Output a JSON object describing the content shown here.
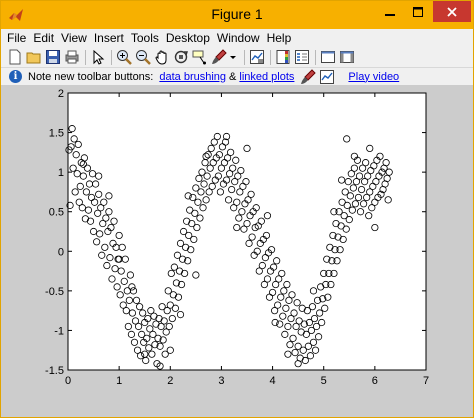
{
  "window": {
    "title": "Figure 1"
  },
  "menu": [
    "File",
    "Edit",
    "View",
    "Insert",
    "Tools",
    "Desktop",
    "Window",
    "Help"
  ],
  "toolbar": {
    "icons": [
      "new-figure-icon",
      "open-file-icon",
      "save-icon",
      "print-icon",
      "edit-plot-icon",
      "zoom-in-icon",
      "zoom-out-icon",
      "pan-icon",
      "rotate-3d-icon",
      "data-cursor-icon",
      "brush-icon",
      "link-plot-icon",
      "colorbar-icon",
      "legend-icon",
      "hide-plot-tools-icon",
      "show-plot-tools-icon"
    ]
  },
  "infobar": {
    "prefix": "Note new toolbar buttons:",
    "link1": "data brushing",
    "amp": "&",
    "link2": "linked plots",
    "link3": "Play video"
  },
  "colors": {
    "titlebar": "#f7b000",
    "close": "#c7372f",
    "figure_bg": "#cccccc",
    "axes_bg": "#ffffff"
  },
  "chart_data": {
    "type": "scatter",
    "marker": "open-circle",
    "xlim": [
      0,
      7
    ],
    "ylim": [
      -1.5,
      2
    ],
    "xticks": [
      0,
      1,
      2,
      3,
      4,
      5,
      6,
      7
    ],
    "yticks": [
      -1.5,
      -1,
      -0.5,
      0,
      0.5,
      1,
      1.5,
      2
    ],
    "xtick_labels": [
      "0",
      "1",
      "2",
      "3",
      "4",
      "5",
      "6",
      "7"
    ],
    "ytick_labels": [
      "-1.5",
      "-1",
      "-0.5",
      "0",
      "0.5",
      "1",
      "1.5",
      "2"
    ],
    "grid": false,
    "points": [
      [
        0.02,
        1.28
      ],
      [
        0.04,
        0.58
      ],
      [
        0.06,
        1.32
      ],
      [
        0.08,
        1.55
      ],
      [
        0.1,
        1.05
      ],
      [
        0.12,
        1.42
      ],
      [
        0.14,
        0.75
      ],
      [
        0.16,
        1.22
      ],
      [
        0.18,
        0.98
      ],
      [
        0.2,
        1.35
      ],
      [
        0.22,
        0.62
      ],
      [
        0.24,
        0.82
      ],
      [
        0.26,
        1.12
      ],
      [
        0.28,
        0.55
      ],
      [
        0.3,
        0.95
      ],
      [
        0.32,
        1.18
      ],
      [
        0.34,
        0.41
      ],
      [
        0.36,
        0.75
      ],
      [
        0.38,
        1.05
      ],
      [
        0.4,
        0.52
      ],
      [
        0.42,
        0.85
      ],
      [
        0.44,
        0.38
      ],
      [
        0.46,
        0.68
      ],
      [
        0.48,
        0.98
      ],
      [
        0.5,
        0.25
      ],
      [
        0.52,
        0.62
      ],
      [
        0.54,
        0.85
      ],
      [
        0.56,
        0.12
      ],
      [
        0.58,
        0.48
      ],
      [
        0.6,
        0.72
      ],
      [
        0.62,
        0.22
      ],
      [
        0.64,
        0.55
      ],
      [
        0.66,
        -0.05
      ],
      [
        0.68,
        0.35
      ],
      [
        0.7,
        0.62
      ],
      [
        0.72,
        0.05
      ],
      [
        0.74,
        0.42
      ],
      [
        0.76,
        -0.18
      ],
      [
        0.78,
        0.25
      ],
      [
        0.8,
        0.5
      ],
      [
        0.82,
        -0.08
      ],
      [
        0.84,
        0.3
      ],
      [
        0.86,
        -0.35
      ],
      [
        0.88,
        0.1
      ],
      [
        0.9,
        0.38
      ],
      [
        0.92,
        -0.22
      ],
      [
        0.94,
        0.05
      ],
      [
        0.96,
        -0.45
      ],
      [
        0.98,
        -0.1
      ],
      [
        1.0,
        0.2
      ],
      [
        1.02,
        -0.55
      ],
      [
        1.04,
        -0.25
      ],
      [
        1.06,
        0.05
      ],
      [
        1.08,
        -0.68
      ],
      [
        1.1,
        -0.38
      ],
      [
        1.12,
        -0.1
      ],
      [
        1.14,
        -0.75
      ],
      [
        1.16,
        -0.5
      ],
      [
        1.18,
        -0.95
      ],
      [
        1.2,
        -0.62
      ],
      [
        1.22,
        -0.3
      ],
      [
        1.24,
        -1.05
      ],
      [
        1.26,
        -0.78
      ],
      [
        1.28,
        -0.5
      ],
      [
        1.3,
        -1.15
      ],
      [
        1.32,
        -0.88
      ],
      [
        1.34,
        -0.62
      ],
      [
        1.36,
        -1.25
      ],
      [
        1.38,
        -0.95
      ],
      [
        1.4,
        -0.7
      ],
      [
        1.42,
        -1.32
      ],
      [
        1.44,
        -1.05
      ],
      [
        1.46,
        -0.78
      ],
      [
        1.48,
        -1.15
      ],
      [
        1.5,
        -0.9
      ],
      [
        1.52,
        -1.38
      ],
      [
        1.54,
        -1.1
      ],
      [
        1.56,
        -0.85
      ],
      [
        1.58,
        -1.22
      ],
      [
        1.6,
        -0.98
      ],
      [
        1.62,
        -0.75
      ],
      [
        1.64,
        -1.3
      ],
      [
        1.66,
        -1.05
      ],
      [
        1.68,
        -0.82
      ],
      [
        1.7,
        -1.18
      ],
      [
        1.72,
        -0.92
      ],
      [
        1.74,
        -1.42
      ],
      [
        1.76,
        -1.1
      ],
      [
        1.78,
        -0.85
      ],
      [
        1.8,
        -1.2
      ],
      [
        1.82,
        -0.95
      ],
      [
        1.84,
        -0.7
      ],
      [
        1.86,
        -1.12
      ],
      [
        1.88,
        -0.88
      ],
      [
        1.9,
        -1.3
      ],
      [
        1.92,
        -1.02
      ],
      [
        1.94,
        -0.75
      ],
      [
        1.96,
        -0.5
      ],
      [
        1.98,
        -0.95
      ],
      [
        2.0,
        -0.68
      ],
      [
        2.02,
        -0.28
      ],
      [
        2.04,
        -0.85
      ],
      [
        2.06,
        -0.55
      ],
      [
        2.08,
        -0.2
      ],
      [
        2.1,
        -0.72
      ],
      [
        2.12,
        -0.4
      ],
      [
        2.14,
        -0.05
      ],
      [
        2.16,
        -0.58
      ],
      [
        2.18,
        -0.25
      ],
      [
        2.2,
        0.1
      ],
      [
        2.22,
        -0.42
      ],
      [
        2.24,
        -0.1
      ],
      [
        2.26,
        0.25
      ],
      [
        2.28,
        -0.28
      ],
      [
        2.3,
        0.05
      ],
      [
        2.32,
        0.38
      ],
      [
        2.34,
        -0.12
      ],
      [
        2.36,
        0.2
      ],
      [
        2.38,
        0.52
      ],
      [
        2.4,
        0.02
      ],
      [
        2.42,
        0.35
      ],
      [
        2.44,
        0.68
      ],
      [
        2.46,
        0.15
      ],
      [
        2.48,
        0.48
      ],
      [
        2.5,
        0.8
      ],
      [
        2.52,
        0.3
      ],
      [
        2.54,
        0.62
      ],
      [
        2.56,
        0.92
      ],
      [
        2.58,
        0.42
      ],
      [
        2.6,
        0.75
      ],
      [
        2.62,
        1.0
      ],
      [
        2.64,
        0.55
      ],
      [
        2.66,
        0.85
      ],
      [
        2.68,
        1.12
      ],
      [
        2.7,
        0.65
      ],
      [
        2.72,
        0.95
      ],
      [
        2.74,
        1.22
      ],
      [
        2.76,
        0.75
      ],
      [
        2.78,
        1.05
      ],
      [
        2.8,
        1.3
      ],
      [
        2.82,
        0.82
      ],
      [
        2.84,
        1.12
      ],
      [
        2.86,
        1.38
      ],
      [
        2.88,
        0.9
      ],
      [
        2.9,
        1.18
      ],
      [
        2.92,
        1.45
      ],
      [
        2.94,
        0.95
      ],
      [
        2.96,
        1.22
      ],
      [
        2.98,
        0.75
      ],
      [
        3.0,
        1.05
      ],
      [
        3.02,
        1.32
      ],
      [
        3.04,
        0.85
      ],
      [
        3.06,
        1.12
      ],
      [
        3.08,
        1.38
      ],
      [
        3.1,
        0.9
      ],
      [
        3.12,
        1.18
      ],
      [
        3.14,
        0.65
      ],
      [
        3.16,
        0.98
      ],
      [
        3.18,
        1.25
      ],
      [
        3.2,
        0.78
      ],
      [
        3.22,
        1.05
      ],
      [
        3.24,
        0.55
      ],
      [
        3.26,
        0.88
      ],
      [
        3.28,
        1.15
      ],
      [
        3.3,
        0.62
      ],
      [
        3.32,
        0.95
      ],
      [
        3.34,
        0.42
      ],
      [
        3.36,
        0.75
      ],
      [
        3.38,
        1.02
      ],
      [
        3.4,
        0.5
      ],
      [
        3.42,
        0.82
      ],
      [
        3.44,
        0.28
      ],
      [
        3.46,
        0.6
      ],
      [
        3.48,
        0.88
      ],
      [
        3.5,
        0.35
      ],
      [
        3.52,
        0.65
      ],
      [
        3.54,
        0.1
      ],
      [
        3.56,
        0.45
      ],
      [
        3.58,
        0.72
      ],
      [
        3.6,
        0.18
      ],
      [
        3.62,
        0.5
      ],
      [
        3.64,
        -0.05
      ],
      [
        3.66,
        0.3
      ],
      [
        3.68,
        0.55
      ],
      [
        3.7,
        0.0
      ],
      [
        3.72,
        0.32
      ],
      [
        3.74,
        -0.25
      ],
      [
        3.76,
        0.1
      ],
      [
        3.78,
        0.38
      ],
      [
        3.8,
        -0.18
      ],
      [
        3.82,
        0.15
      ],
      [
        3.84,
        -0.42
      ],
      [
        3.86,
        -0.08
      ],
      [
        3.88,
        0.2
      ],
      [
        3.9,
        -0.35
      ],
      [
        3.92,
        -0.02
      ],
      [
        3.94,
        -0.58
      ],
      [
        3.96,
        -0.25
      ],
      [
        3.98,
        0.02
      ],
      [
        4.0,
        -0.52
      ],
      [
        4.02,
        -0.2
      ],
      [
        4.04,
        -0.75
      ],
      [
        4.06,
        -0.42
      ],
      [
        4.08,
        -0.12
      ],
      [
        4.1,
        -0.68
      ],
      [
        4.12,
        -0.35
      ],
      [
        4.14,
        -0.92
      ],
      [
        4.16,
        -0.58
      ],
      [
        4.18,
        -0.28
      ],
      [
        4.2,
        -0.82
      ],
      [
        4.22,
        -0.5
      ],
      [
        4.24,
        -1.05
      ],
      [
        4.26,
        -0.72
      ],
      [
        4.28,
        -0.42
      ],
      [
        4.3,
        -0.95
      ],
      [
        4.32,
        -0.62
      ],
      [
        4.34,
        -1.18
      ],
      [
        4.36,
        -0.85
      ],
      [
        4.38,
        -0.55
      ],
      [
        4.4,
        -1.1
      ],
      [
        4.42,
        -0.78
      ],
      [
        4.44,
        -1.28
      ],
      [
        4.46,
        -0.95
      ],
      [
        4.48,
        -0.65
      ],
      [
        4.5,
        -1.2
      ],
      [
        4.52,
        -0.88
      ],
      [
        4.54,
        -1.35
      ],
      [
        4.56,
        -1.02
      ],
      [
        4.58,
        -0.72
      ],
      [
        4.6,
        -1.25
      ],
      [
        4.62,
        -0.92
      ],
      [
        4.64,
        -1.38
      ],
      [
        4.66,
        -1.05
      ],
      [
        4.68,
        -0.75
      ],
      [
        4.7,
        -1.2
      ],
      [
        4.72,
        -0.9
      ],
      [
        4.74,
        -1.32
      ],
      [
        4.76,
        -1.0
      ],
      [
        4.78,
        -0.7
      ],
      [
        4.8,
        -1.15
      ],
      [
        4.82,
        -0.85
      ],
      [
        4.84,
        -1.25
      ],
      [
        4.86,
        -0.95
      ],
      [
        4.88,
        -0.62
      ],
      [
        4.9,
        -1.08
      ],
      [
        4.92,
        -0.78
      ],
      [
        4.94,
        -0.45
      ],
      [
        4.96,
        -0.9
      ],
      [
        4.98,
        -0.6
      ],
      [
        5.0,
        -0.28
      ],
      [
        5.02,
        -0.72
      ],
      [
        5.04,
        -0.42
      ],
      [
        5.06,
        -0.1
      ],
      [
        5.08,
        -0.58
      ],
      [
        5.1,
        -0.28
      ],
      [
        5.12,
        0.05
      ],
      [
        5.14,
        -0.42
      ],
      [
        5.16,
        -0.12
      ],
      [
        5.18,
        0.2
      ],
      [
        5.2,
        -0.28
      ],
      [
        5.22,
        0.02
      ],
      [
        5.24,
        0.35
      ],
      [
        5.26,
        -0.12
      ],
      [
        5.28,
        0.18
      ],
      [
        5.3,
        0.5
      ],
      [
        5.32,
        0.02
      ],
      [
        5.34,
        0.32
      ],
      [
        5.36,
        0.62
      ],
      [
        5.38,
        0.15
      ],
      [
        5.4,
        0.45
      ],
      [
        5.42,
        0.75
      ],
      [
        5.44,
        0.28
      ],
      [
        5.46,
        0.58
      ],
      [
        5.48,
        0.88
      ],
      [
        5.5,
        0.4
      ],
      [
        5.52,
        0.7
      ],
      [
        5.54,
        0.98
      ],
      [
        5.56,
        0.52
      ],
      [
        5.58,
        0.8
      ],
      [
        5.6,
        1.05
      ],
      [
        5.62,
        0.6
      ],
      [
        5.64,
        0.88
      ],
      [
        5.66,
        1.15
      ],
      [
        5.68,
        0.68
      ],
      [
        5.7,
        0.95
      ],
      [
        5.72,
        0.5
      ],
      [
        5.74,
        0.78
      ],
      [
        5.76,
        1.05
      ],
      [
        5.78,
        0.6
      ],
      [
        5.8,
        0.88
      ],
      [
        5.82,
        1.12
      ],
      [
        5.84,
        0.68
      ],
      [
        5.86,
        0.95
      ],
      [
        5.88,
        0.45
      ],
      [
        5.9,
        0.75
      ],
      [
        5.92,
        1.02
      ],
      [
        5.94,
        0.55
      ],
      [
        5.96,
        0.82
      ],
      [
        5.98,
        1.08
      ],
      [
        6.0,
        0.62
      ],
      [
        6.02,
        0.88
      ],
      [
        6.04,
        1.15
      ],
      [
        6.06,
        0.68
      ],
      [
        6.08,
        0.95
      ],
      [
        6.1,
        1.2
      ],
      [
        6.12,
        0.72
      ],
      [
        6.14,
        1.0
      ],
      [
        6.16,
        0.78
      ],
      [
        6.18,
        1.05
      ],
      [
        6.2,
        0.85
      ],
      [
        6.22,
        1.12
      ],
      [
        6.24,
        0.92
      ],
      [
        6.26,
        0.65
      ],
      [
        6.28,
        1.0
      ],
      [
        5.45,
        1.42
      ],
      [
        1.0,
        -0.1
      ],
      [
        2.5,
        -0.3
      ],
      [
        3.5,
        1.3
      ],
      [
        4.5,
        -1.42
      ],
      [
        2.0,
        -1.25
      ],
      [
        0.3,
        1.1
      ],
      [
        0.6,
        0.95
      ],
      [
        1.5,
        -1.3
      ],
      [
        2.2,
        -0.8
      ],
      [
        2.7,
        1.2
      ],
      [
        3.3,
        0.3
      ],
      [
        3.9,
        0.45
      ],
      [
        4.3,
        -1.3
      ],
      [
        4.8,
        -0.5
      ],
      [
        5.2,
        0.5
      ],
      [
        5.6,
        1.2
      ],
      [
        6.0,
        0.3
      ],
      [
        1.8,
        -1.45
      ],
      [
        3.1,
        1.45
      ],
      [
        5.9,
        1.3
      ],
      [
        0.8,
        0.7
      ],
      [
        1.25,
        -0.45
      ],
      [
        2.35,
        0.7
      ],
      [
        4.05,
        -0.9
      ],
      [
        5.35,
        0.9
      ]
    ]
  }
}
